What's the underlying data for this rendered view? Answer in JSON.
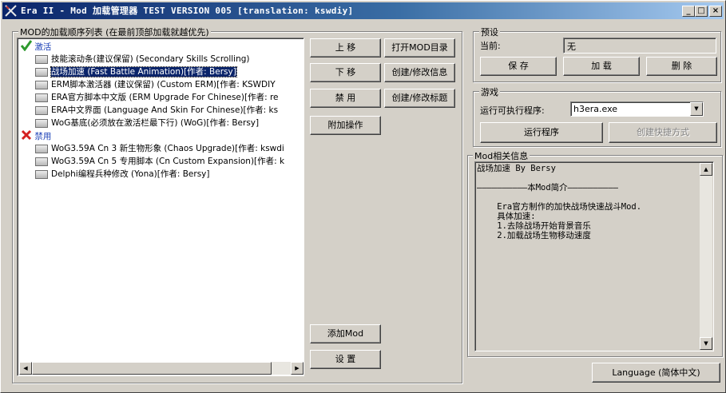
{
  "window": {
    "title": "Era II - Mod 加载管理器 TEST VERSION 005 [translation: kswdiy]",
    "minimize": "_",
    "maximize": "□",
    "close": "×"
  },
  "modlist": {
    "group_label": "MOD的加载顺序列表 (在最前顶部加载就越优先)",
    "enabled_label": "激活",
    "disabled_label": "禁用",
    "enabled": [
      "技能滚动条(建议保留) (Secondary Skills Scrolling)",
      "战场加速 (Fast Battle Animation)[作者: Bersy]",
      "ERM脚本激活器 (建议保留) (Custom ERM)[作者: KSWDIY",
      "ERA官方脚本中文版 (ERM Upgrade For Chinese)[作者: re",
      "ERA中文界面 (Language And Skin For Chinese)[作者: ks",
      "WoG基底(必须放在激活栏最下行) (WoG)[作者: Bersy]"
    ],
    "disabled": [
      "WoG3.59A Cn 3 新生物形象 (Chaos Upgrade)[作者: kswdi",
      "WoG3.59A Cn 5 专用脚本 (Cn Custom Expansion)[作者: k",
      "Delphi编程兵种修改 (Yona)[作者: Bersy]"
    ],
    "selected_index": 1
  },
  "buttons": {
    "move_up": "上 移",
    "move_down": "下 移",
    "disable": "禁 用",
    "extra_ops": "附加操作",
    "open_mod_dir": "打开MOD目录",
    "edit_info": "创建/修改信息",
    "edit_title": "创建/修改标题",
    "add_mod": "添加Mod",
    "settings": "设 置"
  },
  "preset": {
    "label": "预设",
    "current_label": "当前:",
    "current_value": "无",
    "save": "保 存",
    "load": "加 载",
    "delete": "删 除"
  },
  "game": {
    "label": "游戏",
    "exe_label": "运行可执行程序:",
    "exe_value": "h3era.exe",
    "run": "运行程序",
    "shortcut": "创建快捷方式"
  },
  "info": {
    "label": "Mod相关信息",
    "lines": [
      "战场加速 By Bersy",
      "",
      "——————————本Mod简介——————————",
      "",
      "    Era官方制作的加快战场快速战斗Mod.",
      "    具体加速:",
      "    1.去除战场开始背景音乐",
      "    2.加载战场生物移动速度"
    ]
  },
  "language_button": "Language (简体中文)",
  "colors": {
    "titlebar": "#0a246a",
    "selection": "#0a246a",
    "enabled_mark": "#2e9a2e",
    "disabled_mark": "#d42020"
  },
  "icons": {
    "enabled": "check-icon",
    "disabled": "x-icon",
    "folder": "folder-icon"
  }
}
